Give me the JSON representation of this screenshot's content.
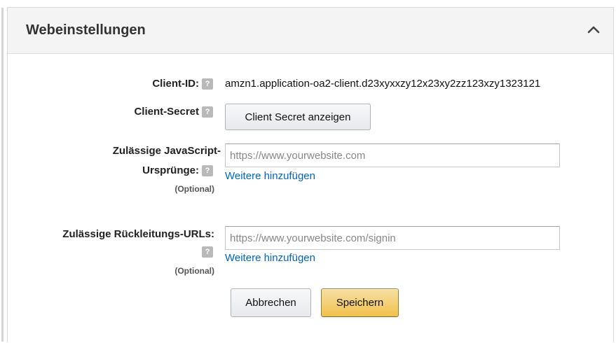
{
  "panel": {
    "title": "Webeinstellungen",
    "collapse_icon": "chevron-up-icon"
  },
  "fields": {
    "client_id": {
      "label": "Client-ID:",
      "value": "amzn1.application-oa2-client.d23xyxxzy12x23xy2zz123xzy1323121",
      "help_icon": "?"
    },
    "client_secret": {
      "label": "Client-Secret",
      "help_icon": "?",
      "button_label": "Client Secret anzeigen"
    },
    "js_origins": {
      "label_line1": "Zulässige JavaScript-",
      "label_line2": "Ursprünge:",
      "optional": "(Optional)",
      "help_icon": "?",
      "placeholder": "https://www.yourwebsite.com",
      "add_more": "Weitere hinzufügen"
    },
    "redirect_urls": {
      "label": "Zulässige Rückleitungs-URLs:",
      "optional": "(Optional)",
      "help_icon": "?",
      "placeholder": "https://www.yourwebsite.com/signin",
      "add_more": "Weitere hinzufügen"
    }
  },
  "actions": {
    "cancel_label": "Abbrechen",
    "save_label": "Speichern"
  },
  "colors": {
    "link": "#0066c0",
    "primary_button": "#f0c14b",
    "header_bg": "#f4f4f4"
  }
}
